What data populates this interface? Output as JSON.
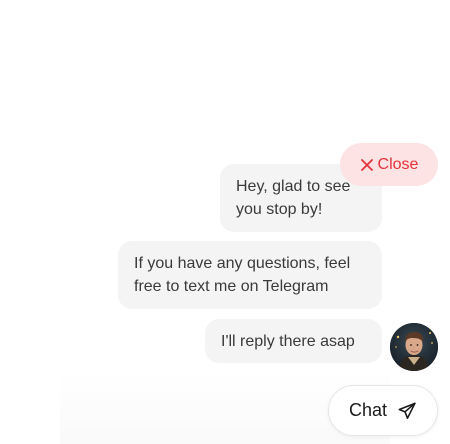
{
  "chat_widget": {
    "close_button": {
      "icon": "close-icon",
      "label": "Close",
      "color": "#e2333b",
      "background": "#fde3e3"
    },
    "messages": [
      {
        "text": "Hey, glad to see you stop by!"
      },
      {
        "text": "If you have any questions, feel free to text me on Telegram"
      },
      {
        "text": "I'll reply there asap"
      }
    ],
    "avatar": {
      "icon": "avatar-photo"
    },
    "chat_button": {
      "label": "Chat",
      "icon": "send-icon"
    }
  }
}
